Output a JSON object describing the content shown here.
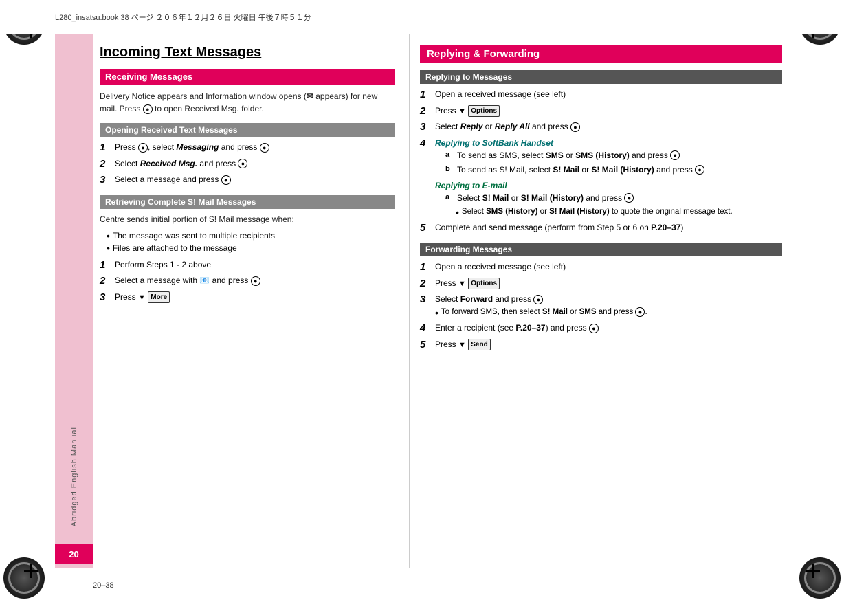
{
  "header": {
    "text": "L280_insatsu.book  38 ページ  ２０６年１２月２６日  火曜日  午後７時５１分"
  },
  "page_number": "20",
  "page_bottom": "20–38",
  "sidebar_text": "Abridged English Manual",
  "left_column": {
    "main_title": "Incoming Text Messages",
    "sections": [
      {
        "id": "receiving",
        "header": "Receiving Messages",
        "body": "Delivery Notice appears and Information window opens (✉ appears) for new mail. Press ● to open Received Msg. folder."
      },
      {
        "id": "opening",
        "header": "Opening Received Text Messages",
        "steps": [
          "Press ●, select Messaging and press ●",
          "Select Received Msg. and press ●",
          "Select a message and press ●"
        ]
      },
      {
        "id": "retrieving",
        "header": "Retrieving Complete S! Mail Messages",
        "body": "Centre sends initial portion of S! Mail message when:",
        "bullets": [
          "The message was sent to multiple recipients",
          "Files are attached to the message"
        ],
        "steps": [
          "Perform Steps 1 - 2 above",
          "Select a message with 📧 and press ●",
          "Press ▼  More"
        ]
      }
    ]
  },
  "right_column": {
    "main_title": "Replying & Forwarding",
    "sections": [
      {
        "id": "replying",
        "header": "Replying to Messages",
        "steps": [
          {
            "num": "1",
            "text": "Open a received message (see left)"
          },
          {
            "num": "2",
            "text": "Press ▼  Options"
          },
          {
            "num": "3",
            "text": "Select Reply or Reply All and press ●"
          },
          {
            "num": "4",
            "label": "Replying to SoftBank Handset",
            "sub": [
              "To send as SMS, select SMS or SMS (History) and press ●",
              "To send as S! Mail, select S! Mail or S! Mail (History) and press ●"
            ]
          },
          {
            "num": "4b",
            "label": "Replying to E-mail",
            "sub": [
              "Select S! Mail or S! Mail (History) and press ●",
              "Select SMS (History) or S! Mail (History) to quote the original message text."
            ]
          },
          {
            "num": "5",
            "text": "Complete and send message (perform from Step 5 or 6 on P.20–37)"
          }
        ]
      },
      {
        "id": "forwarding",
        "header": "Forwarding Messages",
        "steps": [
          {
            "num": "1",
            "text": "Open a received message (see left)"
          },
          {
            "num": "2",
            "text": "Press ▼  Options"
          },
          {
            "num": "3",
            "text": "Select Forward and press ●",
            "sub_bullet": "To forward SMS, then select S! Mail or SMS and press ●."
          },
          {
            "num": "4",
            "text": "Enter a recipient (see P.20–37) and press ●"
          },
          {
            "num": "5",
            "text": "Press ▼  Send"
          }
        ]
      }
    ]
  },
  "icons": {
    "circle": "●",
    "down_arrow": "▼",
    "options_label": "Options",
    "more_label": "More",
    "send_label": "Send"
  }
}
